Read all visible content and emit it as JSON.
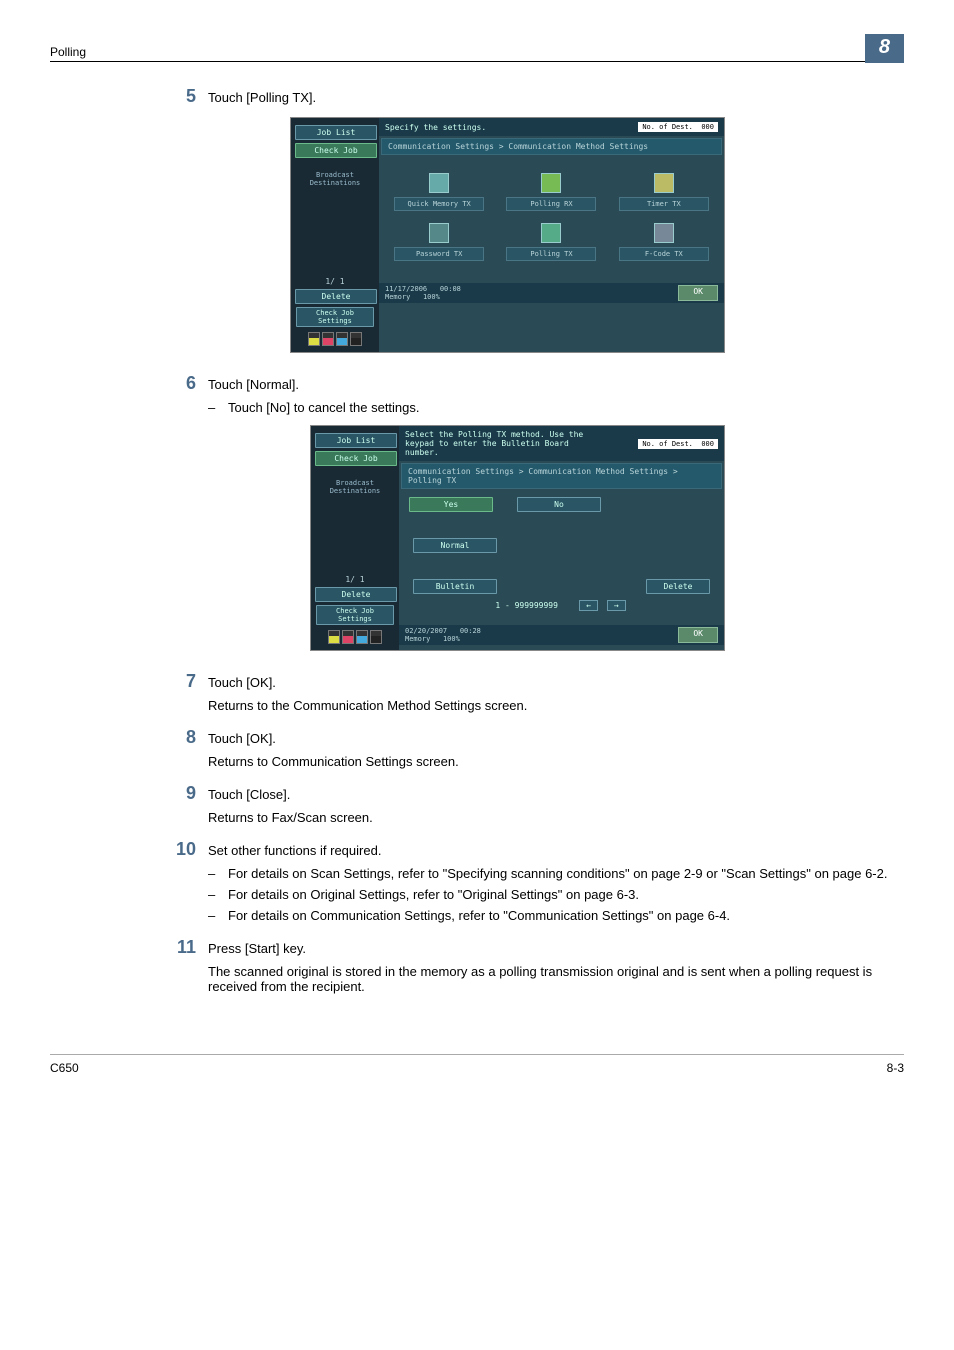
{
  "header": {
    "section": "Polling",
    "chapter": "8"
  },
  "steps": {
    "s5": {
      "num": "5",
      "text": "Touch [Polling TX]."
    },
    "s6": {
      "num": "6",
      "text": "Touch [Normal].",
      "sub1": "Touch [No] to cancel the settings."
    },
    "s7": {
      "num": "7",
      "text": "Touch [OK].",
      "result": "Returns to the Communication Method Settings screen."
    },
    "s8": {
      "num": "8",
      "text": "Touch [OK].",
      "result": "Returns to Communication Settings screen."
    },
    "s9": {
      "num": "9",
      "text": "Touch [Close].",
      "result": "Returns to Fax/Scan screen."
    },
    "s10": {
      "num": "10",
      "text": "Set other functions if required.",
      "sub1": "For details on Scan Settings, refer to \"Specifying scanning conditions\" on page 2-9 or \"Scan Settings\" on page 6-2.",
      "sub2": "For details on Original Settings, refer to \"Original Settings\" on page 6-3.",
      "sub3": "For details on Communication Settings, refer to \"Communication Settings\" on page 6-4."
    },
    "s11": {
      "num": "11",
      "text": "Press [Start] key.",
      "result": "The scanned original is stored in the memory as a polling transmission original and is sent when a polling request is received from the recipient."
    }
  },
  "screenshot1": {
    "left": {
      "job_list": "Job List",
      "check_job": "Check Job",
      "broadcast": "Broadcast Destinations",
      "page": "1/  1",
      "delete": "Delete",
      "check_settings": "Check Job Settings"
    },
    "top_prompt": "Specify the settings.",
    "dest_label": "No. of Dest.",
    "dest_count": "000",
    "breadcrumb": "Communication Settings > Communication Method Settings",
    "tiles": {
      "r1c1": "Quick Memory TX",
      "r1c2": "Polling RX",
      "r1c3": "Timer TX",
      "r2c1": "Password TX",
      "r2c2": "Polling TX",
      "r2c3": "F-Code TX"
    },
    "status_date": "11/17/2006",
    "status_time": "00:08",
    "memory_label": "Memory",
    "memory_val": "100%",
    "ok": "OK",
    "toner_labels": {
      "y": "Y",
      "m": "M",
      "c": "C",
      "k": "K"
    }
  },
  "screenshot2": {
    "left": {
      "job_list": "Job List",
      "check_job": "Check Job",
      "broadcast": "Broadcast Destinations",
      "page": "1/  1",
      "delete": "Delete",
      "check_settings": "Check Job Settings"
    },
    "top_prompt": "Select the Polling TX method. Use the keypad to enter the Bulletin Board number.",
    "dest_label": "No. of Dest.",
    "dest_count": "000",
    "breadcrumb": "Communication Settings > Communication Method Settings > Polling TX",
    "tabs": {
      "yes": "Yes",
      "no": "No"
    },
    "opts": {
      "normal": "Normal",
      "bulletin": "Bulletin"
    },
    "delete": "Delete",
    "range": "1 - 999999999",
    "status_date": "02/20/2007",
    "status_time": "00:28",
    "memory_label": "Memory",
    "memory_val": "100%",
    "ok": "OK",
    "toner_labels": {
      "y": "Y",
      "m": "M",
      "c": "C",
      "k": "K"
    }
  },
  "footer": {
    "model": "C650",
    "page": "8-3"
  }
}
